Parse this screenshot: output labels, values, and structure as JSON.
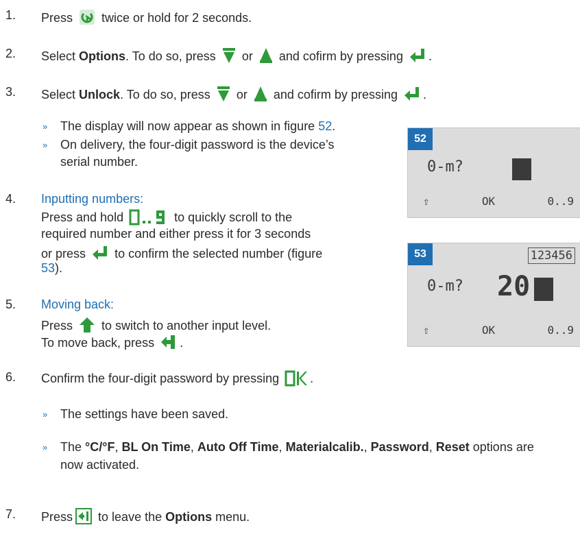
{
  "steps": {
    "s1": {
      "num": "1.",
      "a": "Press",
      "b": "twice or hold for 2 seconds."
    },
    "s2": {
      "num": "2.",
      "a": "Select",
      "bold": "Options",
      "b": ". To do so, press",
      "or": "or",
      "c": "and cofirm by pressing",
      "end": "."
    },
    "s3": {
      "num": "3.",
      "a": "Select",
      "bold": "Unlock",
      "b": ". To do so, press",
      "or": "or",
      "c": "and cofirm by pressing",
      "end": "."
    },
    "bullets1": [
      "The display will now appear as shown in figure",
      "On delivery, the four-digit password is the device’s",
      "serial number."
    ],
    "fig52_ref": "52",
    "s4": {
      "num": "4.",
      "heading": "Inputting numbers:",
      "l1a": "Press and hold",
      "l1b": "to quickly scroll to the",
      "l2": "required number and either press it for 3 seconds",
      "l3a": "or press",
      "l3b": "to confirm the selected number (figure",
      "l4ref": "53",
      "l4end": ")."
    },
    "s5": {
      "num": "5.",
      "heading": "Moving back:",
      "l1a": "Press",
      "l1b": "to switch to another input level.",
      "l2a": "To move back, press",
      "l2end": "."
    },
    "s6": {
      "num": "6.",
      "a": "Confirm the four-digit password by pressing",
      "end": "."
    },
    "bullet_saved": "The settings have been saved.",
    "bullet_opts": {
      "a": "The",
      "o1": "°C/°F",
      "s1": ",",
      "o2": "BL On Time",
      "s2": ",",
      "o3": "Auto Off Time",
      "s3": ",",
      "o4": "Materialcalib.",
      "s4": ",",
      "o5": "Password",
      "s5": ",",
      "o6": "Reset",
      "b": "options are",
      "l2": "now activated."
    },
    "s7": {
      "num": "7.",
      "a": "Press",
      "b": "to leave the",
      "bold": "Options",
      "c": "menu."
    },
    "bullet_glyph": "»"
  },
  "figures": {
    "f52": {
      "label": "52",
      "key": "0-m?",
      "bottom": [
        "⇧",
        "OK",
        "0..9"
      ]
    },
    "f53": {
      "label": "53",
      "key": "0-m?",
      "value": "20",
      "serial": "123456",
      "bottom": [
        "⇧",
        "OK",
        "0..9"
      ]
    }
  },
  "icons": {
    "accent": "#1f6fb2",
    "icon_green": "#2e9a3a",
    "names": [
      "power-mode-icon",
      "down-arrow-icon",
      "up-arrow-icon",
      "enter-icon",
      "digit-range-icon",
      "shift-icon",
      "backspace-icon",
      "ok-icon",
      "exit-icon"
    ]
  }
}
